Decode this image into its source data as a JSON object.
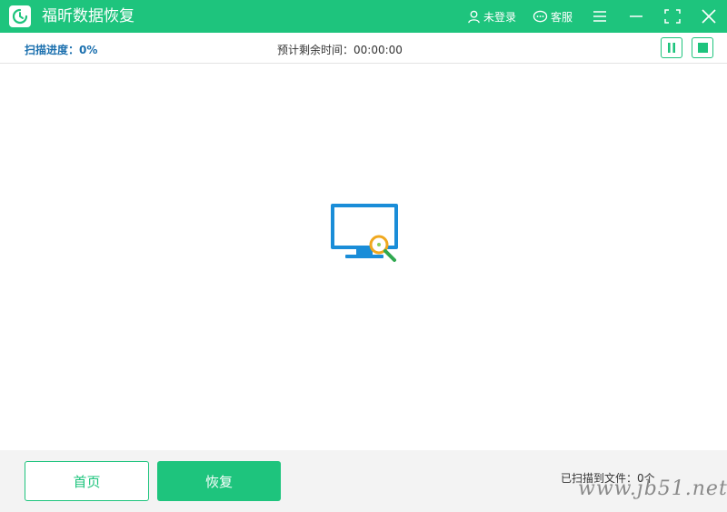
{
  "app": {
    "title": "福昕数据恢复"
  },
  "titlebar": {
    "login_label": "未登录",
    "service_label": "客服",
    "accent_color": "#1ec47d"
  },
  "scan": {
    "progress_label": "扫描进度：0%",
    "remaining_label": "预计剩余时间：00:00:00"
  },
  "footer": {
    "home_label": "首页",
    "recover_label": "恢复",
    "found_label": "已扫描到文件：0个",
    "watermark": "www.jb51.net"
  }
}
